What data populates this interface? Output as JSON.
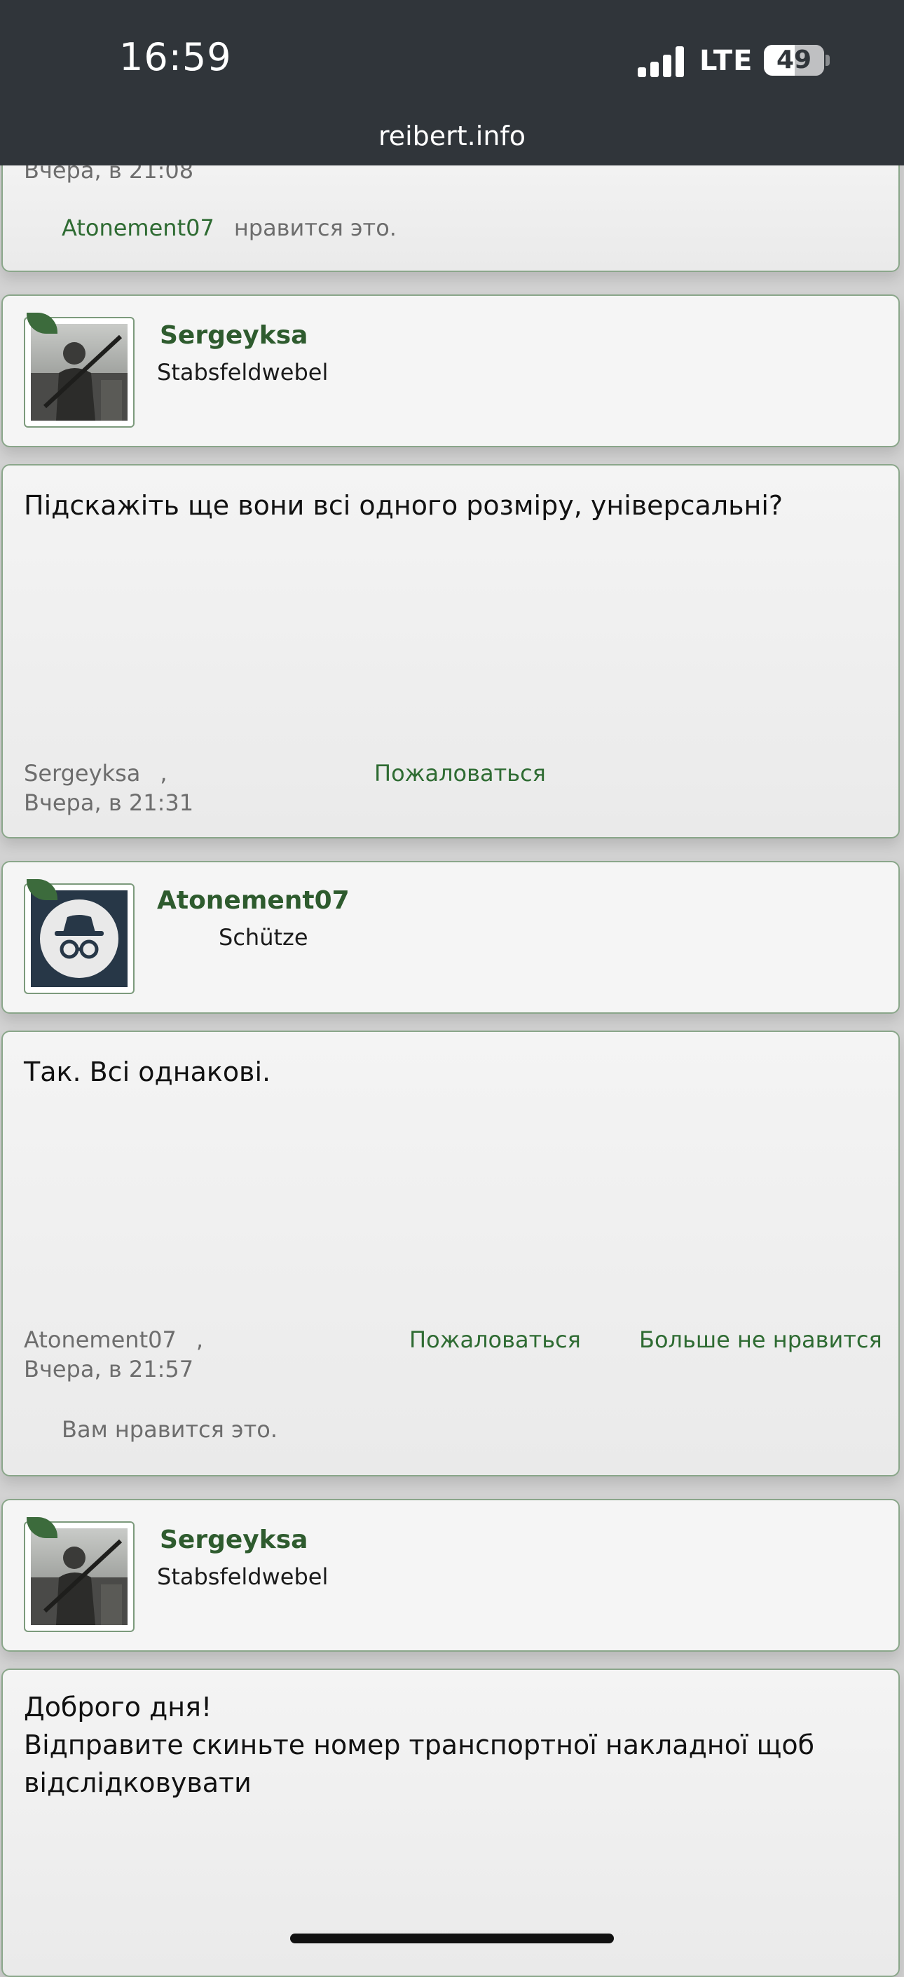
{
  "status_bar": {
    "time": "16:59",
    "network": "LTE",
    "battery": "49"
  },
  "browser": {
    "url": "reibert.info"
  },
  "prev_post": {
    "timestamp": "Вчера, в 21:08",
    "liked_by": "Atonement07",
    "liked_suffix": "нравится это."
  },
  "posts": [
    {
      "username": "Sergeyksa",
      "rank": "Stabsfeldwebel",
      "avatar": "soldier-photo",
      "message": "Підскажіть ще вони всі одного розміру, універсальні?",
      "author": "Sergeyksa",
      "comma": ",",
      "timestamp": "Вчера, в 21:31",
      "report_label": "Пожаловаться"
    },
    {
      "username": "Atonement07",
      "rank": "Schütze",
      "avatar": "incognito-icon",
      "message": "Так. Всі однакові.",
      "author": "Atonement07",
      "comma": ",",
      "timestamp": "Вчера, в 21:57",
      "report_label": "Пожаловаться",
      "unlike_label": "Больше не нравится",
      "like_status": "Вам нравится это."
    },
    {
      "username": "Sergeyksa",
      "rank": "Stabsfeldwebel",
      "avatar": "soldier-photo",
      "message_lines": [
        "Доброго дня!",
        "Відправите скиньте номер транспортної накладної щоб",
        "відслідковувати"
      ]
    }
  ]
}
